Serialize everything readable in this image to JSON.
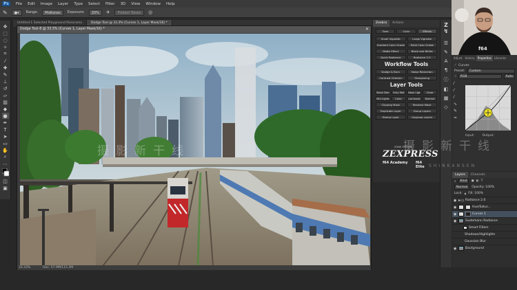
{
  "app": {
    "logo": "Ps",
    "menu": [
      "File",
      "Edit",
      "Image",
      "Layer",
      "Type",
      "Select",
      "Filter",
      "3D",
      "View",
      "Window",
      "Help"
    ]
  },
  "options_bar": {
    "tool_icon": "brush-icon",
    "mode_label": "Range:",
    "mode_value": "Midtones",
    "exposure_label": "Exposure:",
    "exposure_value": "20%",
    "protect_label": "Protect Tones"
  },
  "document": {
    "tabs": [
      "Untitled-1 Selected Playground Panorama",
      "Dodge Tool @ 33.3% (Curves 1, Layer Mask/16) *"
    ],
    "title": "Dodge Tool-8 @ 33.3% (Curves 1, Layer Mask/16) *",
    "zoom": "33.33%",
    "doc_size": "Doc: 57.9M/115.2M"
  },
  "actions_panel": {
    "tabs": [
      "Zeebra",
      "Actions"
    ],
    "subtabs": [
      "Tone",
      "Color",
      "Effects"
    ],
    "effects_rows": [
      [
        "Small Vignette",
        "Large Vignette"
      ],
      [
        "Gradient Color Grade",
        "Solid Color Grade"
      ],
      [
        "Matte Effect",
        "Black and White"
      ],
      [
        "Quick Radiance",
        "Radiance 2.0"
      ]
    ],
    "workflow_title": "Workflow Tools",
    "workflow_rows": [
      [
        "Dodge & Burn",
        "Noise Reduction"
      ],
      [
        "Contrast Checker",
        "Sharpening"
      ]
    ],
    "layer_title": "Layer Tools",
    "layer_rows": [
      [
        "Mask Dark",
        "Only Mid",
        "Mask Light",
        "Clear"
      ],
      [
        "Mid Lights",
        "Color",
        "Luminosity",
        "Normal"
      ],
      [
        "Clipping Mask",
        "Rename Mask"
      ],
      [
        "Duplicate Layer",
        "Group Layers"
      ],
      [
        "Stamp Layer",
        "Ungroup Layers"
      ]
    ],
    "brand_sub": "ZONE SYSTEM",
    "brand_word": "ZEXPRESS",
    "brand_left": "f64 Academy",
    "brand_right": "f64 Elite"
  },
  "properties_panel": {
    "tabs": [
      "Adjust",
      "History",
      "Properties",
      "Libraries"
    ],
    "active_tab": "Properties",
    "type_label": "Curves",
    "preset_label": "Preset:",
    "preset_value": "Custom",
    "channel_value": "RGB",
    "auto_label": "Auto",
    "input_label": "Input:",
    "output_label": "Output:"
  },
  "layers_panel": {
    "tabs": [
      "Layers",
      "Channels"
    ],
    "kind_label": "Kind",
    "blend_mode": "Normal",
    "opacity_label": "Opacity: 100%",
    "fill_label": "Fill: 100%",
    "lock_label": "Lock:",
    "rows": [
      {
        "name": "Radiance 2.0",
        "kind": "group"
      },
      {
        "name": "Hue/Satur...",
        "kind": "adj"
      },
      {
        "name": "Curves 1",
        "kind": "adj",
        "selected": true
      },
      {
        "name": "Gudemann Radiance",
        "kind": "layer"
      },
      {
        "name": "Smart Filters",
        "kind": "sub"
      },
      {
        "name": "Shadows/Highlights",
        "kind": "sub"
      },
      {
        "name": "Gaussian Blur",
        "kind": "sub"
      },
      {
        "name": "Background",
        "kind": "photo"
      }
    ]
  },
  "webcam": {
    "shirt_text": "f64"
  },
  "watermark": {
    "line1": "摄影新干线",
    "line2": "SHINKANSEN"
  },
  "colors": {
    "chrome_dark": "#282828",
    "panel": "#2e2e2e",
    "accent": "#44505e",
    "sky": "#b5c9d3",
    "tree": "#2f6a2a",
    "train_red": "#c2282a",
    "train_blue": "#4e79b2"
  },
  "icons": {
    "toolbar": [
      "move-icon",
      "marquee-icon",
      "lasso-icon",
      "quick-select-icon",
      "crop-icon",
      "eyedropper-icon",
      "healing-icon",
      "brush-icon",
      "clone-stamp-icon",
      "history-brush-icon",
      "eraser-icon",
      "gradient-icon",
      "dodge-icon",
      "pen-icon",
      "type-icon",
      "path-select-icon",
      "shape-icon",
      "hand-icon",
      "zoom-icon",
      "more-tools-icon",
      "color-swatch-icon",
      "quick-mask-icon",
      "screen-mode-icon"
    ]
  }
}
